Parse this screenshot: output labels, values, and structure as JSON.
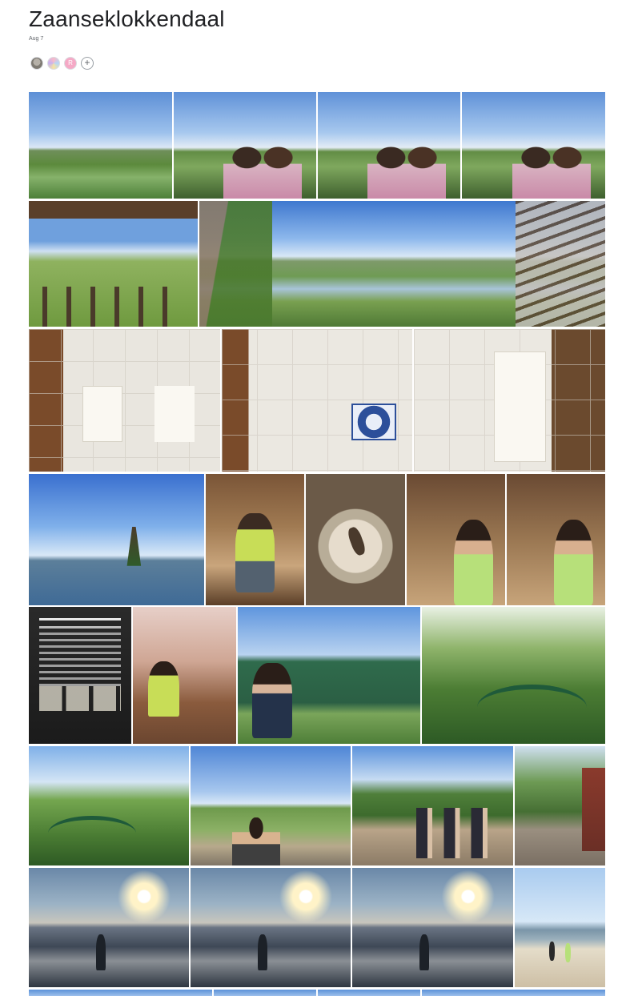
{
  "album": {
    "title": "Zaanseklokkendaal",
    "date": "Aug 7"
  },
  "people": [
    {
      "name": "avatar-1"
    },
    {
      "name": "avatar-2"
    },
    {
      "name": "avatar-3",
      "initial": "R"
    }
  ],
  "add_people_icon": "+"
}
